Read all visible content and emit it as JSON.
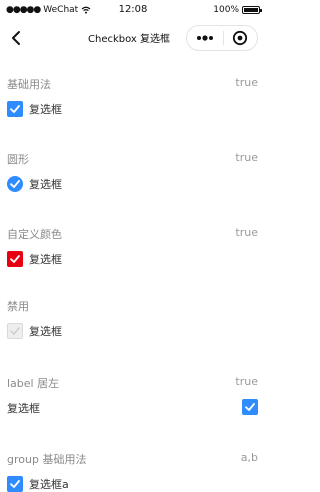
{
  "status_bar": {
    "carrier": "WeChat",
    "time": "12:08",
    "battery": "100%"
  },
  "nav": {
    "title": "Checkbox 复选框"
  },
  "sections": [
    {
      "title": "基础用法",
      "value": "true",
      "label": "复选框"
    },
    {
      "title": "圆形",
      "value": "true",
      "label": "复选框"
    },
    {
      "title": "自定义颜色",
      "value": "true",
      "label": "复选框"
    },
    {
      "title": "禁用",
      "value": "",
      "label": "复选框"
    },
    {
      "title": "label 居左",
      "value": "true",
      "label": "复选框"
    },
    {
      "title": "group 基础用法",
      "value": "a,b",
      "label": "复选框a"
    }
  ],
  "colors": {
    "accent": "#2f8cff",
    "custom": "#e60012",
    "disabled": "#eeeeee"
  }
}
